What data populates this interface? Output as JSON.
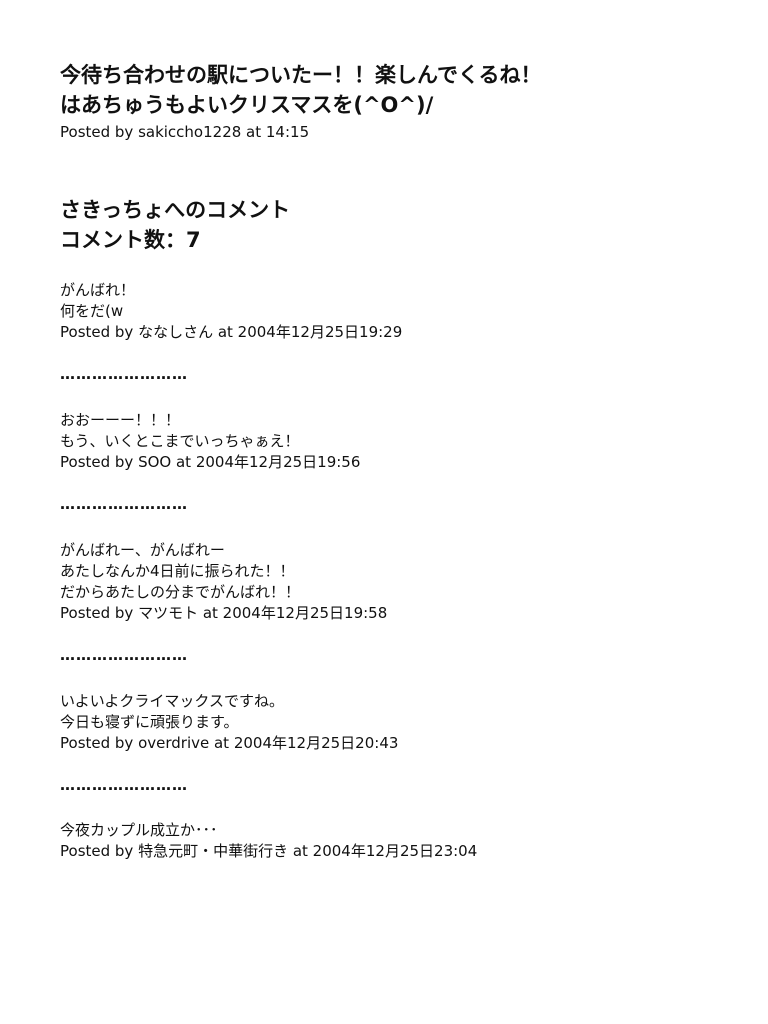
{
  "post": {
    "lines": [
      "今待ち合わせの駅についたー！！楽しんでくるね！",
      "はあちゅうもよいクリスマスを(^O^)/"
    ],
    "posted_by": "Posted by sakiccho1228 at 14:15"
  },
  "comments_heading": {
    "title": "さきっちょへのコメント",
    "count": "コメント数：7"
  },
  "separator": "……………………",
  "comments": [
    {
      "lines": [
        "がんばれ！",
        "何をだ(w"
      ],
      "posted_by": "Posted by  ななしさん  at 2004年12月25日19:29"
    },
    {
      "lines": [
        "おおーーー！！！",
        "もう、いくとこまでいっちゃぁえ！"
      ],
      "posted_by": "Posted by SOO at 2004年12月25日19:56"
    },
    {
      "lines": [
        "がんばれー、がんばれー",
        "あたしなんか4日前に振られた！！",
        "だからあたしの分までがんばれ！！"
      ],
      "posted_by": "Posted by  マツモト  at 2004年12月25日19:58"
    },
    {
      "lines": [
        "いよいよクライマックスですね。",
        "今日も寝ずに頑張ります。"
      ],
      "posted_by": "Posted by overdrive at 2004年12月25日20:43"
    },
    {
      "lines": [
        "今夜カップル成立か･･･"
      ],
      "posted_by": "Posted by  特急元町・中華街行き  at 2004年12月25日23:04"
    }
  ]
}
